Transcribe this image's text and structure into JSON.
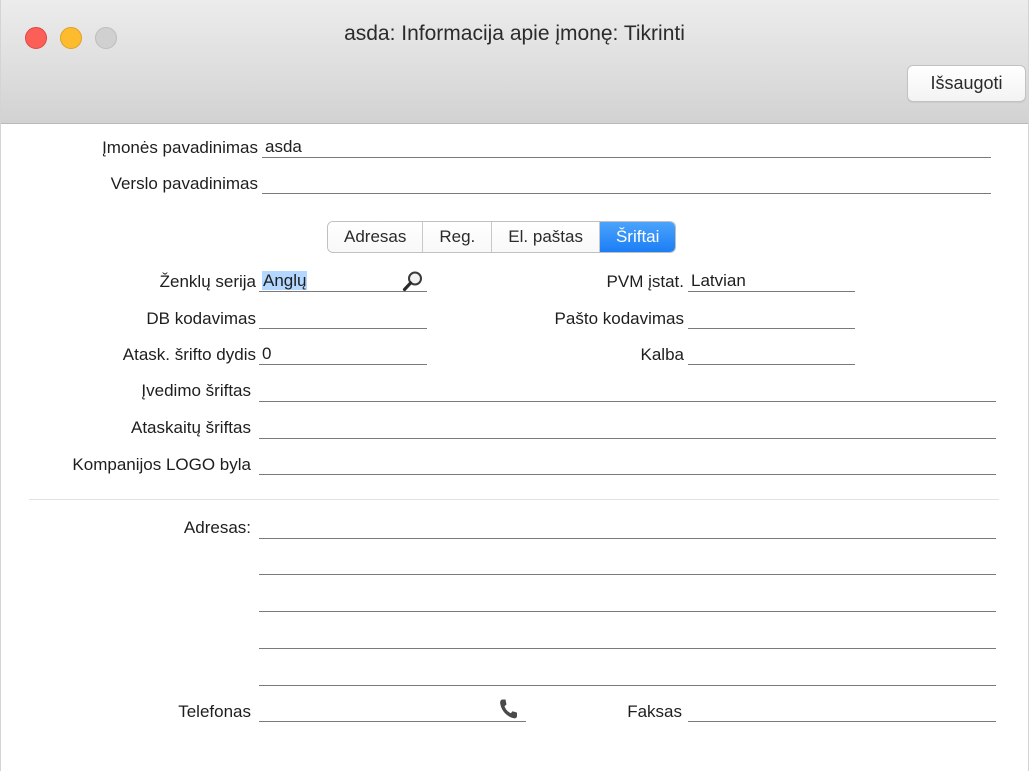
{
  "window": {
    "title": "asda: Informacija apie įmonę: Tikrinti",
    "save_label": "Išsaugoti"
  },
  "company": {
    "name_label": "Įmonės pavadinimas",
    "name_value": "asda",
    "business_label": "Verslo pavadinimas",
    "business_value": ""
  },
  "tabs": [
    {
      "label": "Adresas",
      "active": false
    },
    {
      "label": "Reg.",
      "active": false
    },
    {
      "label": "El. paštas",
      "active": false
    },
    {
      "label": "Šriftai",
      "active": true
    }
  ],
  "fonts": {
    "charset_label": "Ženklų serija",
    "charset_value": "Anglų",
    "db_encoding_label": "DB kodavimas",
    "db_encoding_value": "",
    "report_font_size_label": "Atask. šrifto dydis",
    "report_font_size_value": "0",
    "entry_font_label": "Įvedimo šriftas",
    "entry_font_value": "",
    "report_font_label": "Ataskaitų šriftas",
    "report_font_value": "",
    "logo_file_label": "Kompanijos LOGO byla",
    "logo_file_value": "",
    "vat_label": "PVM įstat.",
    "vat_value": "Latvian",
    "mail_encoding_label": "Pašto kodavimas",
    "mail_encoding_value": "",
    "language_label": "Kalba",
    "language_value": ""
  },
  "address": {
    "label": "Adresas:",
    "lines": [
      "",
      "",
      "",
      "",
      ""
    ],
    "phone_label": "Telefonas",
    "phone_value": "",
    "fax_label": "Faksas",
    "fax_value": ""
  },
  "icons": {
    "lookup": "search-icon",
    "phone": "phone-icon"
  },
  "colors": {
    "accent": "#1b7ef5",
    "selection": "#b3d7ff",
    "close": "#fc5f57",
    "minimize": "#fdbc2e",
    "zoom": "#d0d0d0"
  }
}
